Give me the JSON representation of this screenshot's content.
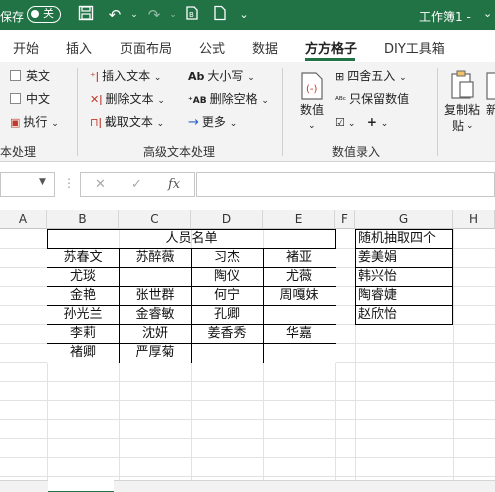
{
  "titlebar": {
    "autosave_label": "保存",
    "toggle_state": "关",
    "doc_title": "工作簿1 -",
    "bg_color": "#217346"
  },
  "tabs": [
    "开始",
    "插入",
    "页面布局",
    "公式",
    "数据",
    "方方格子",
    "DIY工具箱"
  ],
  "active_tab": "方方格子",
  "ribbon": {
    "text_group": {
      "english": "英文",
      "chinese": "中文",
      "execute": "执行",
      "group_label": "本处理"
    },
    "advanced_text": {
      "insert_text": "插入文本",
      "delete_text": "删除文本",
      "extract_text": "截取文本",
      "case": "大小写",
      "delete_spaces": "删除空格",
      "more": "更多",
      "group_label": "高级文本处理"
    },
    "number_entry": {
      "numeric": "数值",
      "round": "四舍五入",
      "keep_numeric": "只保留数值",
      "group_label": "数值录入"
    },
    "clipboard": {
      "copy_paste_line1": "复制粘",
      "copy_paste_line2": "贴",
      "new_partial": "新"
    }
  },
  "formula_bar": {
    "name_box": "",
    "fx_label": "fx",
    "formula": ""
  },
  "columns": [
    "A",
    "B",
    "C",
    "D",
    "E",
    "F",
    "G",
    "H"
  ],
  "roster": {
    "title": "人员名单",
    "rows": [
      [
        "苏春文",
        "苏醉薇",
        "习杰",
        "褚亚"
      ],
      [
        "尤琰",
        "",
        "陶仪",
        "尤薇"
      ],
      [
        "金艳",
        "张世群",
        "何宁",
        "周嘎妹"
      ],
      [
        "孙光兰",
        "金睿敏",
        "孔卿",
        ""
      ],
      [
        "李莉",
        "沈妍",
        "姜香秀",
        "华嘉"
      ],
      [
        "褚卿",
        "严厚菊",
        "",
        ""
      ]
    ]
  },
  "random_pick": {
    "header": "随机抽取四个",
    "names": [
      "姜美娟",
      "韩兴怡",
      "陶睿婕",
      "赵欣怡"
    ]
  }
}
